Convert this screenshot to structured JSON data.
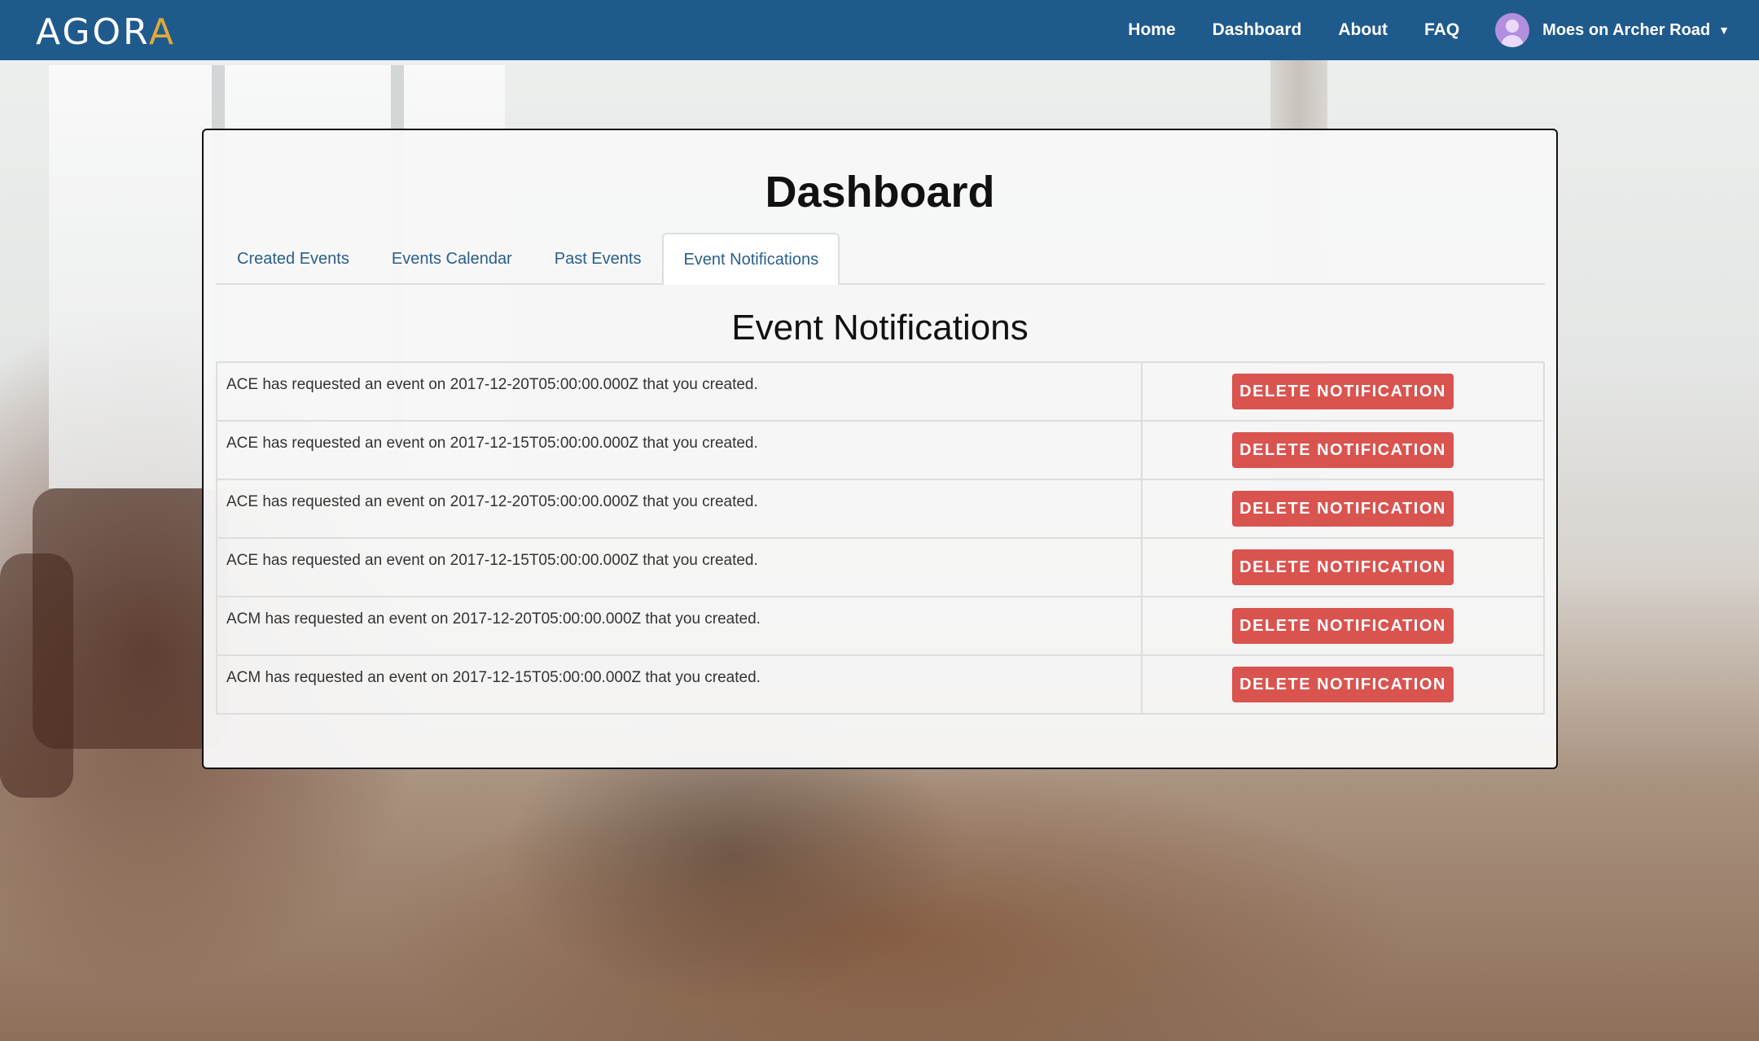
{
  "brand": {
    "logo_text_pre": "AGOR",
    "logo_text_a": "A",
    "colors": {
      "navbar": "#1f5a8c",
      "accent": "#e0a83a",
      "danger": "#d9534f",
      "link": "#2a5f8c"
    }
  },
  "nav": {
    "links": [
      "Home",
      "Dashboard",
      "About",
      "FAQ"
    ],
    "user_name": "Moes on Archer Road",
    "user_icon": "user-avatar-icon",
    "caret_icon": "caret-down-icon"
  },
  "main": {
    "title": "Dashboard",
    "tabs": [
      {
        "label": "Created Events",
        "active": false
      },
      {
        "label": "Events Calendar",
        "active": false
      },
      {
        "label": "Past Events",
        "active": false
      },
      {
        "label": "Event Notifications",
        "active": true
      }
    ],
    "section_title": "Event Notifications",
    "notifications": [
      {
        "text": "ACE has requested an event on 2017-12-20T05:00:00.000Z that you created.",
        "button": "DELETE NOTIFICATION"
      },
      {
        "text": "ACE has requested an event on 2017-12-15T05:00:00.000Z that you created.",
        "button": "DELETE NOTIFICATION"
      },
      {
        "text": "ACE has requested an event on 2017-12-20T05:00:00.000Z that you created.",
        "button": "DELETE NOTIFICATION"
      },
      {
        "text": "ACE has requested an event on 2017-12-15T05:00:00.000Z that you created.",
        "button": "DELETE NOTIFICATION"
      },
      {
        "text": "ACM has requested an event on 2017-12-20T05:00:00.000Z that you created.",
        "button": "DELETE NOTIFICATION"
      },
      {
        "text": "ACM has requested an event on 2017-12-15T05:00:00.000Z that you created.",
        "button": "DELETE NOTIFICATION"
      }
    ]
  }
}
